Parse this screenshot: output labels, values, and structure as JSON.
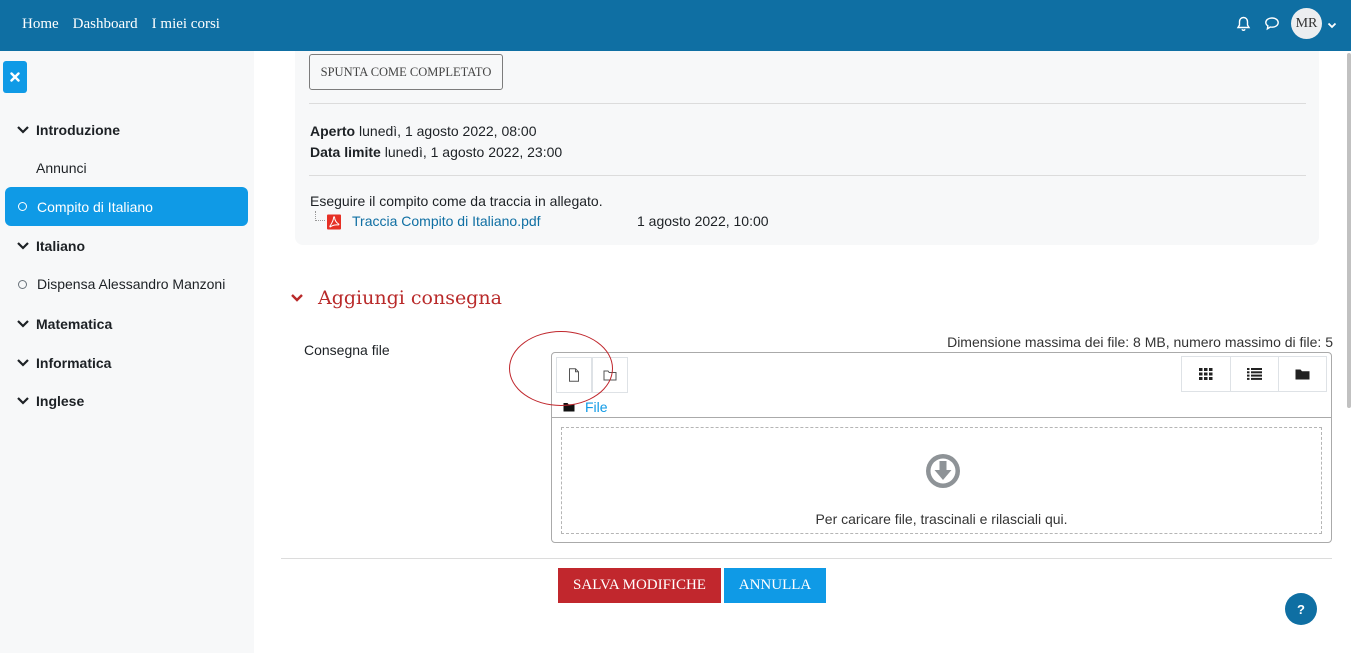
{
  "navbar": {
    "links": [
      "Home",
      "Dashboard",
      "I miei corsi"
    ],
    "user_initials": "MR"
  },
  "drawer": {
    "sections": [
      {
        "label": "Introduzione"
      },
      {
        "label": "Italiano"
      },
      {
        "label": "Matematica"
      },
      {
        "label": "Informatica"
      },
      {
        "label": "Inglese"
      }
    ],
    "activities": {
      "annunci": "Annunci",
      "compito": "Compito di Italiano",
      "dispensa": "Dispensa Alessandro Manzoni"
    }
  },
  "activity": {
    "complete_button": "SPUNTA COME COMPLETATO",
    "opened_label": "Aperto",
    "opened_value": "lunedì, 1 agosto 2022, 08:00",
    "due_label": "Data limite",
    "due_value": "lunedì, 1 agosto 2022, 23:00",
    "description": "Eseguire il compito come da traccia in allegato.",
    "attachment_name": "Traccia Compito di Italiano.pdf",
    "attachment_date": "1 agosto 2022, 10:00"
  },
  "submission": {
    "title": "Aggiungi consegna",
    "field_label": "Consegna file",
    "limits": "Dimensione massima dei file: 8 MB, numero massimo di file: 5",
    "path_label": "File",
    "drop_text": "Per caricare file, trascinali e rilasciali qui.",
    "save_button": "SALVA MODIFICHE",
    "cancel_button": "ANNULLA"
  },
  "colors": {
    "navbar": "#0f6fa3",
    "accent": "#0f9ae6",
    "danger": "#c1272d",
    "heading_red": "#b92a2a"
  },
  "help_label": "?"
}
